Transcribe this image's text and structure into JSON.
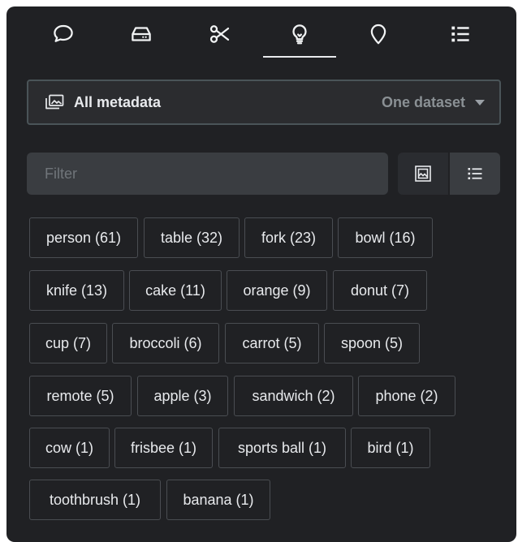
{
  "tabs": [
    {
      "icon": "chat-bubble-icon"
    },
    {
      "icon": "hard-drive-icon"
    },
    {
      "icon": "scissors-icon"
    },
    {
      "icon": "lightbulb-icon",
      "active": true
    },
    {
      "icon": "map-pin-icon"
    },
    {
      "icon": "list-icon"
    }
  ],
  "source": {
    "label": "All metadata",
    "scope": "One dataset",
    "icon": "image-stack-icon"
  },
  "filter": {
    "placeholder": "Filter",
    "value": ""
  },
  "view": {
    "options": [
      {
        "icon": "object-detect-icon"
      },
      {
        "icon": "list-view-icon",
        "active": true
      }
    ]
  },
  "tags": [
    "person (61)",
    "table (32)",
    "fork (23)",
    "bowl (16)",
    "knife (13)",
    "cake (11)",
    "orange (9)",
    "donut (7)",
    "cup (7)",
    "broccoli (6)",
    "carrot (5)",
    "spoon (5)",
    "remote (5)",
    "apple (3)",
    "sandwich (2)",
    "phone (2)",
    "cow (1)",
    "frisbee (1)",
    "sports ball (1)",
    "bird (1)",
    "toothbrush (1)",
    "banana (1)"
  ],
  "colors": {
    "panel": "#202124",
    "text": "#e8eaed",
    "muted": "#8a9094",
    "border": "#4a4d52"
  }
}
